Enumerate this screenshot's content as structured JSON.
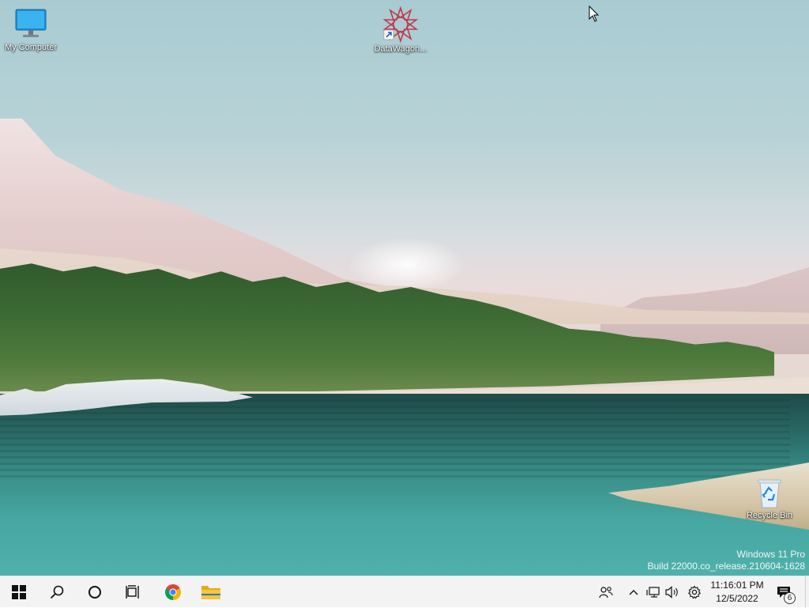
{
  "desktop": {
    "icons": [
      {
        "label": "My Computer",
        "icon": "monitor-icon"
      },
      {
        "label": "DataWagon...",
        "icon": "datawagon-app-icon"
      },
      {
        "label": "Recycle Bin",
        "icon": "recycle-bin-icon"
      }
    ],
    "watermark": {
      "line1": "Windows 11 Pro",
      "line2": "Build 22000.co_release.210604-1628"
    }
  },
  "taskbar": {
    "buttons": [
      {
        "name": "start",
        "icon": "windows-logo-icon"
      },
      {
        "name": "search",
        "icon": "search-icon"
      },
      {
        "name": "cortana",
        "icon": "cortana-circle-icon"
      },
      {
        "name": "task-view",
        "icon": "task-view-icon"
      },
      {
        "name": "chrome",
        "icon": "chrome-icon"
      },
      {
        "name": "file-explorer",
        "icon": "folder-icon"
      }
    ],
    "tray": {
      "icons": [
        "people-icon",
        "chevron-up-icon",
        "network-icon",
        "volume-icon",
        "settings-gear-icon"
      ],
      "time": "11:16:01 PM",
      "date": "12/5/2022",
      "notification_count": "6"
    }
  },
  "colors": {
    "taskbar_bg": "#f3f3f3",
    "chrome_red": "#db4437",
    "chrome_green": "#0f9d58",
    "chrome_yellow": "#f4b400",
    "chrome_blue": "#4285f4",
    "folder_yellow": "#f8c53a",
    "datawagon_red": "#c0394a"
  }
}
